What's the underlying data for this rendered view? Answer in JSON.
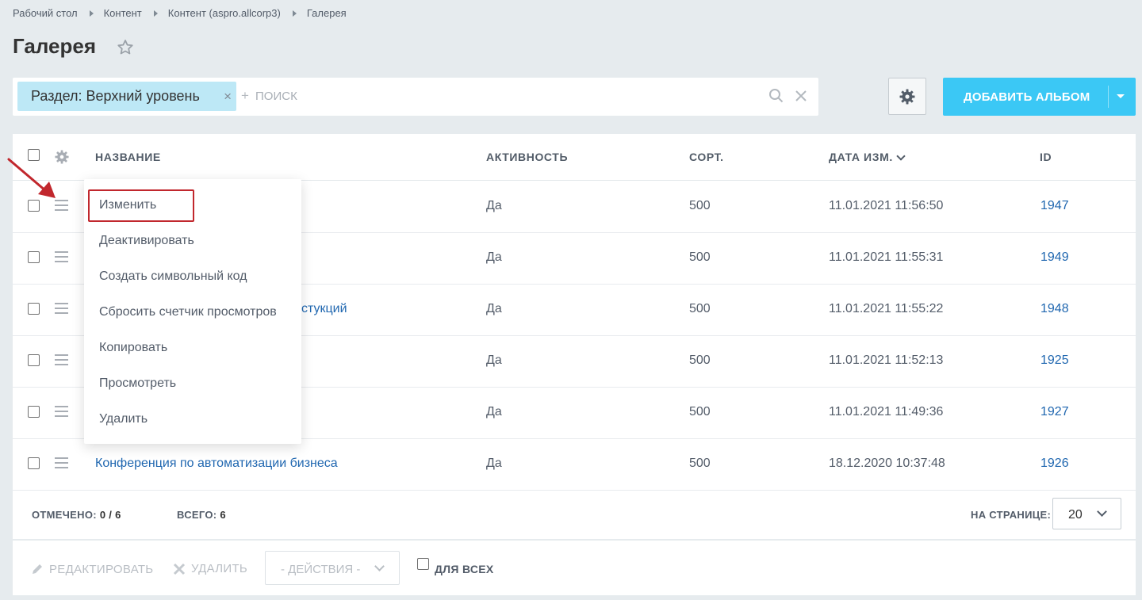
{
  "breadcrumb": [
    "Рабочий стол",
    "Контент",
    "Контент (aspro.allcorp3)",
    "Галерея"
  ],
  "page_title": "Галерея",
  "filter": {
    "chip_label": "Раздел: Верхний уровень",
    "chip_close": "×",
    "plus": "+",
    "placeholder": "поиск"
  },
  "add_button": {
    "label": "ДОБАВИТЬ АЛЬБОМ"
  },
  "table": {
    "columns": {
      "name": "НАЗВАНИЕ",
      "active": "АКТИВНОСТЬ",
      "sort": "СОРТ.",
      "date": "ДАТА ИЗМ.",
      "id": "ID"
    },
    "rows": [
      {
        "name": "",
        "active": "Да",
        "sort": "500",
        "date": "11.01.2021 11:56:50",
        "id": "1947"
      },
      {
        "name": "",
        "active": "Да",
        "sort": "500",
        "date": "11.01.2021 11:55:31",
        "id": "1949"
      },
      {
        "name": "стукций",
        "active": "Да",
        "sort": "500",
        "date": "11.01.2021 11:55:22",
        "id": "1948"
      },
      {
        "name": "",
        "active": "Да",
        "sort": "500",
        "date": "11.01.2021 11:52:13",
        "id": "1925"
      },
      {
        "name": "",
        "active": "Да",
        "sort": "500",
        "date": "11.01.2021 11:49:36",
        "id": "1927"
      },
      {
        "name": "Конференция по автоматизации бизнеса",
        "active": "Да",
        "sort": "500",
        "date": "18.12.2020 10:37:48",
        "id": "1926"
      }
    ]
  },
  "context_menu": [
    "Изменить",
    "Деактивировать",
    "Создать символьный код",
    "Сбросить счетчик просмотров",
    "Копировать",
    "Просмотреть",
    "Удалить"
  ],
  "footer": {
    "checked_label": "ОТМЕЧЕНО:",
    "checked_value": "0 / 6",
    "total_label": "ВСЕГО:",
    "total_value": "6",
    "per_page_label": "НА СТРАНИЦЕ:",
    "per_page_value": "20",
    "edit_label": "РЕДАКТИРОВАТЬ",
    "delete_label": "УДАЛИТЬ",
    "actions_label": "- ДЕЙСТВИЯ -",
    "for_all_label": "ДЛЯ ВСЕХ"
  },
  "colors": {
    "accent": "#3bc8f5",
    "link": "#2067b0",
    "chip": "#bde8f6",
    "highlight": "#c1272d"
  }
}
